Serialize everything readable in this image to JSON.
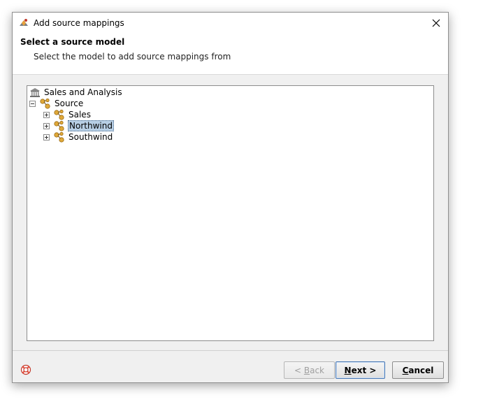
{
  "window": {
    "title": "Add source mappings",
    "icon": "wizard-app-icon"
  },
  "header": {
    "title": "Select a source model",
    "subtitle": "Select the model to add source mappings from"
  },
  "tree": {
    "root": {
      "label": "Sales and Analysis",
      "icon": "bank-building-icon"
    },
    "source": {
      "label": "Source",
      "icon": "source-model-icon",
      "expanded": true
    },
    "children": [
      {
        "label": "Sales",
        "icon": "source-model-icon",
        "expanded": false,
        "selected": false
      },
      {
        "label": "Northwind",
        "icon": "source-model-icon",
        "expanded": false,
        "selected": true
      },
      {
        "label": "Southwind",
        "icon": "source-model-icon",
        "expanded": false,
        "selected": false
      }
    ]
  },
  "buttons": {
    "back_mnemonic": "B",
    "back_rest": "ack",
    "back_prefix": "< ",
    "next_mnemonic": "N",
    "next_rest": "ext >",
    "cancel_mnemonic": "C",
    "cancel_rest": "ancel"
  },
  "colors": {
    "selection": "#b8cfe5",
    "dialog_bg": "#f0f0f0"
  }
}
